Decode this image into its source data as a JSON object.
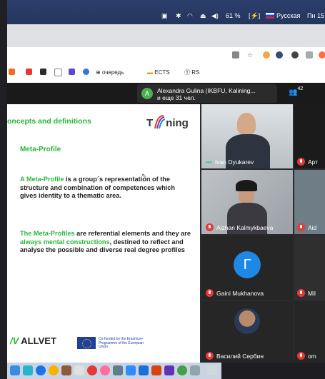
{
  "menubar": {
    "battery": "61 %",
    "input_language": "Русская",
    "clock": "Пн 15"
  },
  "bookmarks": [
    {
      "label": "очередь",
      "icon": "globe-icon"
    },
    {
      "label": "ECTS",
      "icon": "folder-icon"
    },
    {
      "label": "RS",
      "icon": "rs-icon"
    }
  ],
  "notification": {
    "avatar_letter": "A",
    "line1": "Alexandra Gulina (IKBFU, Kalining...",
    "line2": "и еще 31 чел."
  },
  "participants_count": "42",
  "slide": {
    "title": "oncepts and definitions",
    "logo": {
      "pre": "T",
      "post": "ning"
    },
    "heading": "Meta-Profile",
    "p1_green": "A Meta-Profile",
    "p1_rest": " is a group´s representation of the structure and combination of competences which gives identity to a thematic area.",
    "p2_green": "The Meta-Profiles",
    "p2_mid": " are referential elements and they are ",
    "p2_green2": "always mental constructions",
    "p2_rest": ", destined to reflect and analyse the possible and diverse real degree profiles",
    "footer_brand": "ALLVET",
    "eu_text": "Co-funded by the Erasmus+ Programme of the European Union"
  },
  "tiles": [
    {
      "name": "Ivan Dyukarev",
      "muted": false
    },
    {
      "name": "Арт",
      "muted": true
    },
    {
      "name": "Aizhan Kalmykbaeva",
      "muted": true
    },
    {
      "name": "Aid",
      "muted": true
    },
    {
      "name": "Gaini Mukhanova",
      "muted": true,
      "avatar": "Г"
    },
    {
      "name": "Mil",
      "muted": true
    },
    {
      "name": "Василий Сербин",
      "muted": true
    },
    {
      "name": "om",
      "muted": true
    }
  ],
  "colors": {
    "accent_green": "#2bb63a",
    "mic_red": "#e53935",
    "avatar_blue": "#1e88e5"
  }
}
